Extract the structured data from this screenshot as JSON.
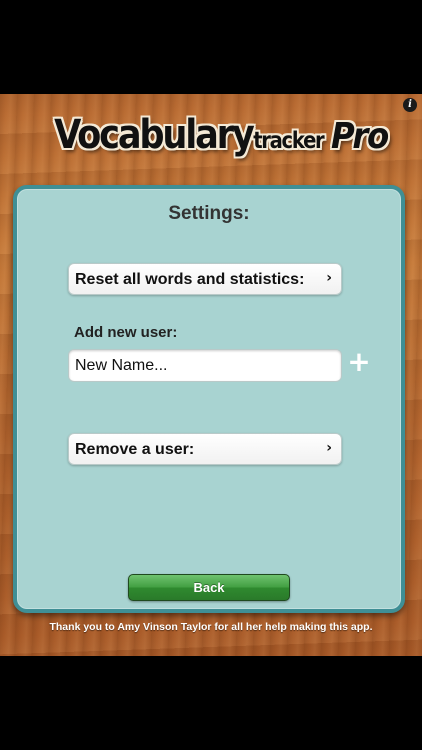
{
  "header": {
    "logo_vocabulary": "Vocabulary",
    "logo_tracker": "tracker",
    "logo_pro": "Pro",
    "info_icon": "i"
  },
  "settings": {
    "title": "Settings:",
    "reset_label": "Reset all words and statistics:",
    "add_user_label": "Add new user:",
    "new_name_placeholder": "New Name...",
    "plus_icon": "+",
    "remove_label": "Remove a user:",
    "chevron_icon": "›",
    "back_label": "Back"
  },
  "footer": {
    "thanks": "Thank you to Amy Vinson Taylor for all her help making this app."
  },
  "colors": {
    "panel_background": "#a8d3d1",
    "panel_border": "#3f8f95",
    "back_button": "#43a043",
    "wood": "#b86a32"
  }
}
